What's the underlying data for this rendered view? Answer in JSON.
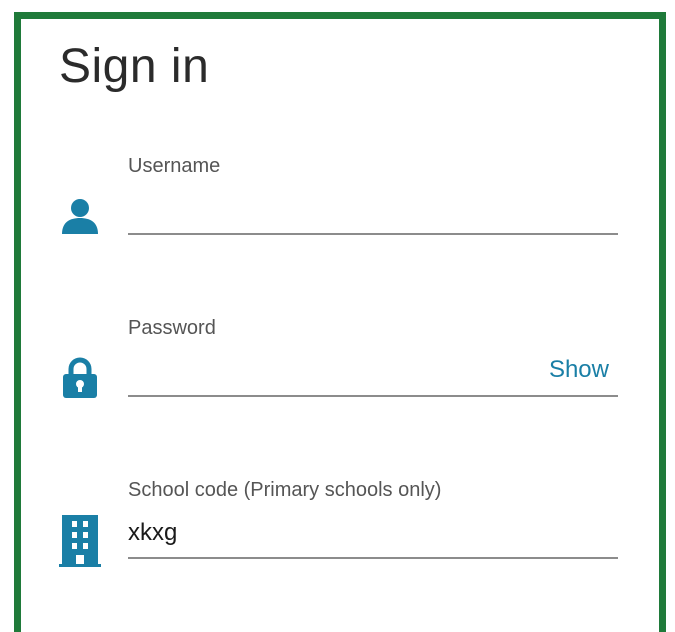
{
  "form": {
    "title": "Sign in",
    "username": {
      "label": "Username",
      "value": "",
      "icon": "user-icon"
    },
    "password": {
      "label": "Password",
      "value": "",
      "show_label": "Show",
      "icon": "lock-icon"
    },
    "school_code": {
      "label": "School code (Primary schools only)",
      "value": "xkxg",
      "icon": "building-icon"
    }
  },
  "colors": {
    "border": "#1f7a3a",
    "icon": "#1a7fa6",
    "link": "#1a7fa6",
    "underline": "#8c8c8c"
  }
}
